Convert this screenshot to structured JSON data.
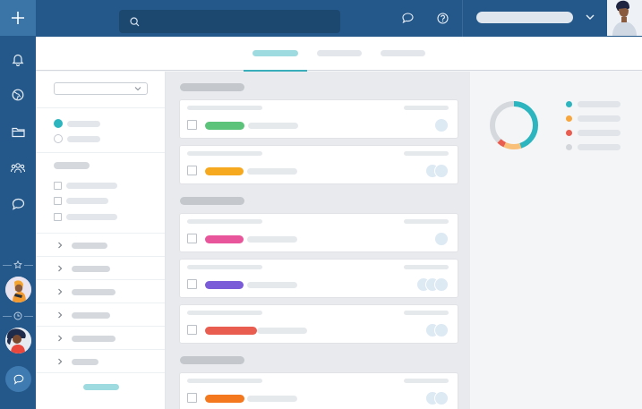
{
  "colors": {
    "rail": "#24588a",
    "accent": "#2db5bf",
    "tag_green": "#5cc37a",
    "tag_yellow": "#f6a91f",
    "tag_pink": "#e9559a",
    "tag_purple": "#7a5cd8",
    "tag_red": "#e95d50",
    "tag_orange": "#f3781e"
  },
  "rail": {
    "icons": [
      "plus-icon",
      "bell-icon",
      "globe-icon",
      "folder-icon",
      "team-icon",
      "chat-icon",
      "pin-icon",
      "clock-icon",
      "chat-bubble-icon"
    ]
  },
  "header": {
    "search": {
      "value": "",
      "placeholder": ""
    },
    "icons": [
      "message-icon",
      "help-icon",
      "chevron-down-icon"
    ]
  },
  "tabs": [
    {
      "active": true
    },
    {
      "active": false
    },
    {
      "active": false
    }
  ],
  "tasks": {
    "groups": [
      {
        "cards": [
          {
            "tag_color": "#5cc37a",
            "avatars": 1
          },
          {
            "tag_color": "#f6a91f",
            "avatars": 2
          }
        ]
      },
      {
        "cards": [
          {
            "tag_color": "#e9559a",
            "avatars": 1
          },
          {
            "tag_color": "#7a5cd8",
            "avatars": 3
          },
          {
            "tag_color": "#e95d50",
            "avatars": 2
          }
        ]
      },
      {
        "cards": [
          {
            "tag_color": "#f3781e",
            "avatars": 2
          }
        ]
      }
    ]
  },
  "summary": {
    "donut": [
      {
        "color": "#2db5bf",
        "fraction": 0.45
      },
      {
        "color": "#f9c07a",
        "fraction": 0.12
      },
      {
        "color": "#e95d50",
        "fraction": 0.05
      },
      {
        "color": "#d5d8dc",
        "fraction": 0.38
      }
    ]
  }
}
